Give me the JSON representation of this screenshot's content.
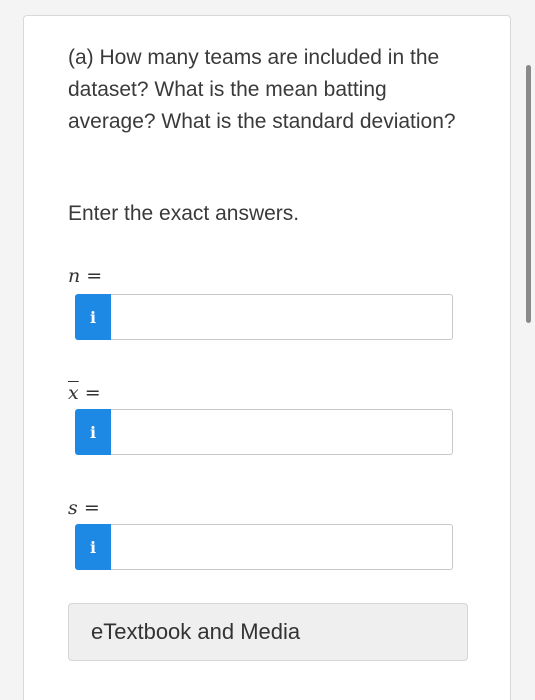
{
  "question": {
    "text": "(a) How many teams are included in the dataset? What is the mean batting average? What is the standard deviation?"
  },
  "instruction": "Enter the exact answers.",
  "fields": [
    {
      "symbol": "n",
      "equals": "=",
      "info_label": "i",
      "value": "",
      "placeholder": ""
    },
    {
      "symbol": "x",
      "equals": "=",
      "info_label": "i",
      "value": "",
      "placeholder": ""
    },
    {
      "symbol": "s",
      "equals": "=",
      "info_label": "i",
      "value": "",
      "placeholder": ""
    }
  ],
  "etextbook_button": "eTextbook and Media",
  "colors": {
    "info_button": "#1e88e5",
    "etextbook_bg": "#efefef"
  }
}
